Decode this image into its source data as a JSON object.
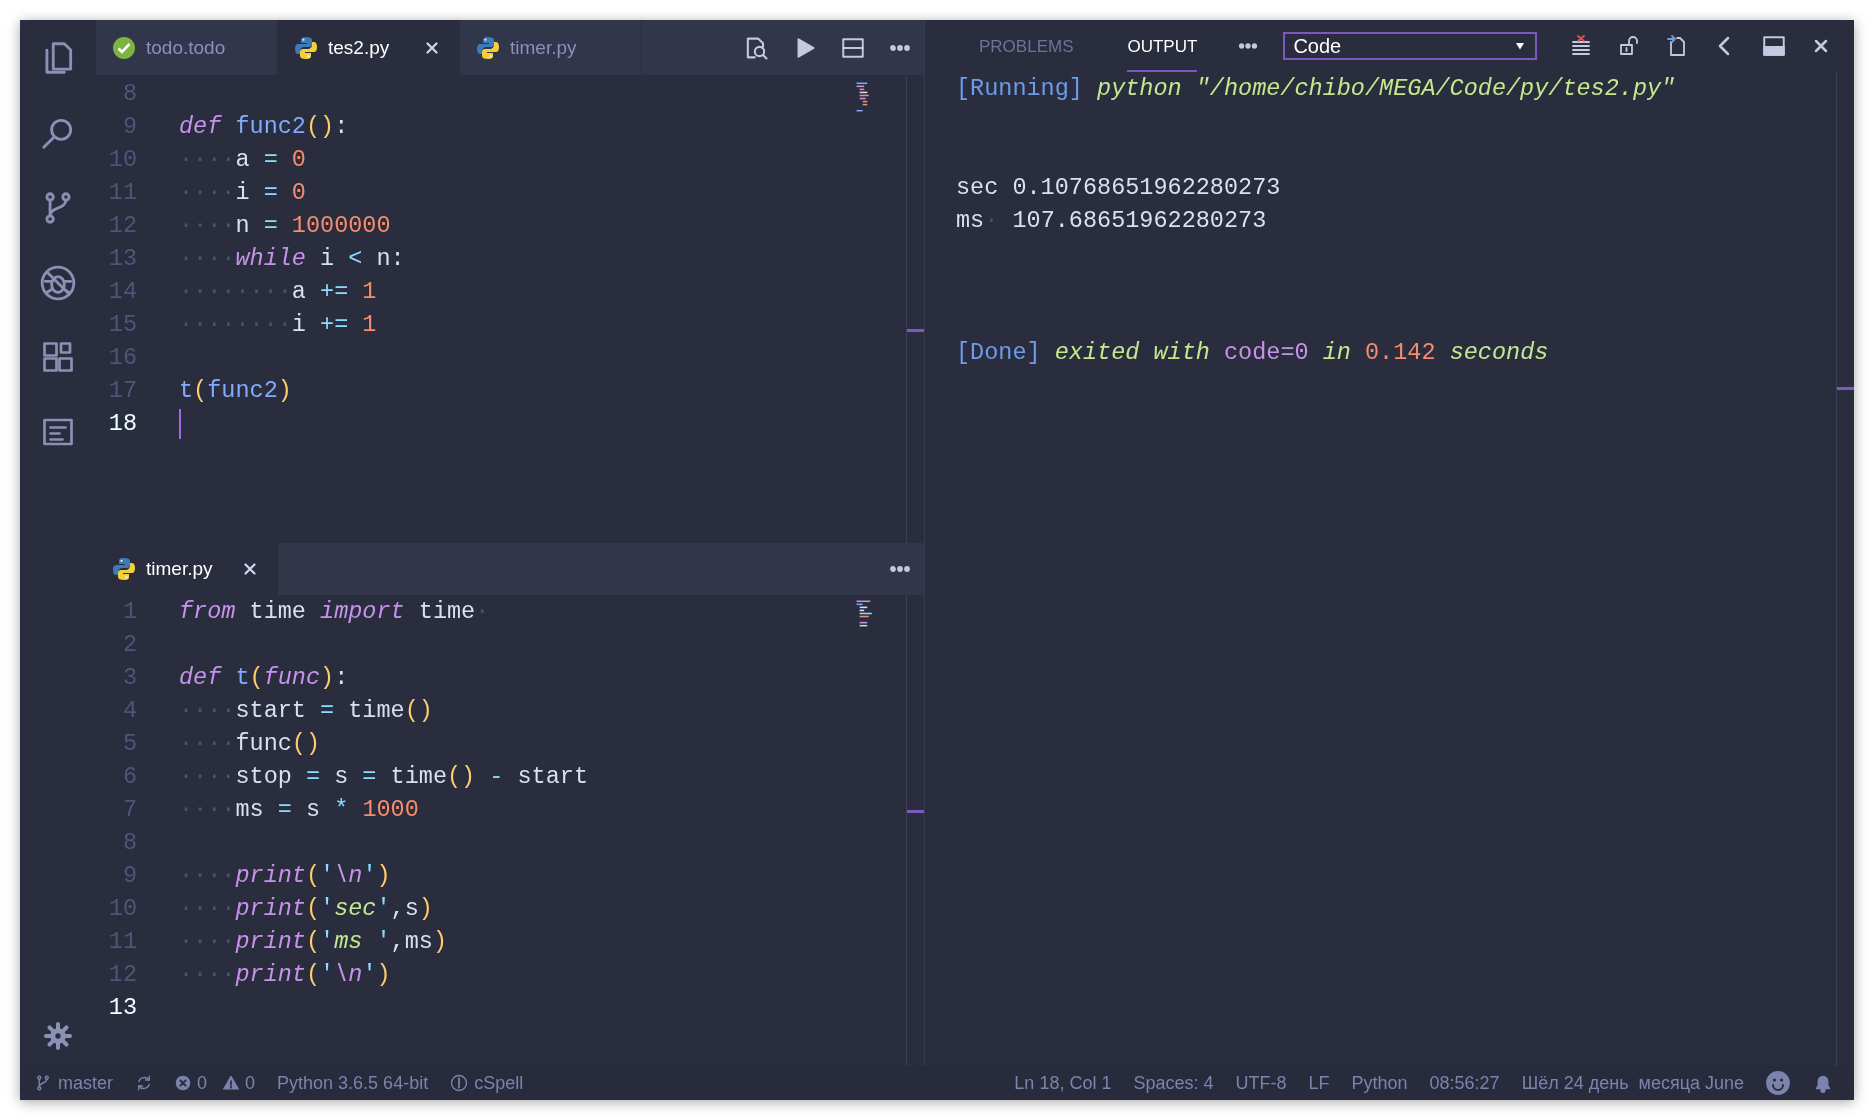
{
  "editor_top": {
    "focused": true,
    "tabs": [
      {
        "label": "todo.todo",
        "kind": "todo",
        "selected": false
      },
      {
        "label": "tes2.py",
        "kind": "python",
        "selected": true
      },
      {
        "label": "timer.py",
        "kind": "python",
        "selected": false
      }
    ],
    "lines": [
      {
        "number": "8",
        "current": false
      },
      {
        "number": "9",
        "current": false,
        "tokens": [
          {
            "kind": "kw",
            "text": "def "
          },
          {
            "kind": "fn",
            "text": "func2"
          },
          {
            "kind": "par",
            "text": "()"
          },
          {
            "kind": "plain",
            "text": ":"
          }
        ]
      },
      {
        "number": "10",
        "current": false,
        "tokens": [
          {
            "kind": "ws",
            "text": "····"
          },
          {
            "kind": "plain",
            "text": "a "
          },
          {
            "kind": "op",
            "text": "= "
          },
          {
            "kind": "num",
            "text": "0"
          }
        ]
      },
      {
        "number": "11",
        "current": false,
        "tokens": [
          {
            "kind": "ws",
            "text": "····"
          },
          {
            "kind": "plain",
            "text": "i "
          },
          {
            "kind": "op",
            "text": "= "
          },
          {
            "kind": "num",
            "text": "0"
          }
        ]
      },
      {
        "number": "12",
        "current": false,
        "tokens": [
          {
            "kind": "ws",
            "text": "····"
          },
          {
            "kind": "plain",
            "text": "n "
          },
          {
            "kind": "op",
            "text": "= "
          },
          {
            "kind": "num",
            "text": "1000000"
          }
        ]
      },
      {
        "number": "13",
        "current": false,
        "tokens": [
          {
            "kind": "ws",
            "text": "····"
          },
          {
            "kind": "kw",
            "text": "while"
          },
          {
            "kind": "plain",
            "text": " i "
          },
          {
            "kind": "op",
            "text": "<"
          },
          {
            "kind": "plain",
            "text": " n:"
          }
        ]
      },
      {
        "number": "14",
        "current": false,
        "tokens": [
          {
            "kind": "ws",
            "text": "········"
          },
          {
            "kind": "plain",
            "text": "a "
          },
          {
            "kind": "op",
            "text": "+= "
          },
          {
            "kind": "num",
            "text": "1"
          }
        ]
      },
      {
        "number": "15",
        "current": false,
        "tokens": [
          {
            "kind": "ws",
            "text": "········"
          },
          {
            "kind": "plain",
            "text": "i "
          },
          {
            "kind": "op",
            "text": "+= "
          },
          {
            "kind": "num",
            "text": "1"
          }
        ]
      },
      {
        "number": "16",
        "current": false
      },
      {
        "number": "17",
        "current": false,
        "tokens": [
          {
            "kind": "fn",
            "text": "t"
          },
          {
            "kind": "par",
            "text": "("
          },
          {
            "kind": "fn",
            "text": "func2"
          },
          {
            "kind": "par",
            "text": ")"
          }
        ]
      },
      {
        "number": "18",
        "current": true
      }
    ]
  },
  "editor_bottom": {
    "focused": false,
    "tabs": [
      {
        "label": "timer.py",
        "kind": "python",
        "selected": true
      }
    ],
    "lines": [
      {
        "number": "1",
        "current": false,
        "tokens": [
          {
            "kind": "kw",
            "text": "from"
          },
          {
            "kind": "plain",
            "text": " time "
          },
          {
            "kind": "kw",
            "text": "import"
          },
          {
            "kind": "plain",
            "text": " time"
          },
          {
            "kind": "ws",
            "text": "·"
          }
        ]
      },
      {
        "number": "2",
        "current": false
      },
      {
        "number": "3",
        "current": false,
        "tokens": [
          {
            "kind": "kw",
            "text": "def "
          },
          {
            "kind": "fn",
            "text": "t"
          },
          {
            "kind": "par",
            "text": "("
          },
          {
            "kind": "param",
            "text": "func"
          },
          {
            "kind": "par",
            "text": ")"
          },
          {
            "kind": "plain",
            "text": ":"
          }
        ]
      },
      {
        "number": "4",
        "current": false,
        "tokens": [
          {
            "kind": "ws",
            "text": "····"
          },
          {
            "kind": "plain",
            "text": "start "
          },
          {
            "kind": "op",
            "text": "="
          },
          {
            "kind": "plain",
            "text": " time"
          },
          {
            "kind": "par",
            "text": "()"
          }
        ]
      },
      {
        "number": "5",
        "current": false,
        "tokens": [
          {
            "kind": "ws",
            "text": "····"
          },
          {
            "kind": "plain",
            "text": "func"
          },
          {
            "kind": "par",
            "text": "()"
          }
        ]
      },
      {
        "number": "6",
        "current": false,
        "tokens": [
          {
            "kind": "ws",
            "text": "····"
          },
          {
            "kind": "plain",
            "text": "stop "
          },
          {
            "kind": "op",
            "text": "="
          },
          {
            "kind": "plain",
            "text": " s "
          },
          {
            "kind": "op",
            "text": "="
          },
          {
            "kind": "plain",
            "text": " time"
          },
          {
            "kind": "par",
            "text": "() "
          },
          {
            "kind": "op",
            "text": "-"
          },
          {
            "kind": "plain",
            "text": " start"
          }
        ]
      },
      {
        "number": "7",
        "current": false,
        "tokens": [
          {
            "kind": "ws",
            "text": "····"
          },
          {
            "kind": "plain",
            "text": "ms "
          },
          {
            "kind": "op",
            "text": "="
          },
          {
            "kind": "plain",
            "text": " s "
          },
          {
            "kind": "op",
            "text": "* "
          },
          {
            "kind": "num",
            "text": "1000"
          }
        ]
      },
      {
        "number": "8",
        "current": false
      },
      {
        "number": "9",
        "current": false,
        "tokens": [
          {
            "kind": "ws",
            "text": "····"
          },
          {
            "kind": "kw",
            "text": "print"
          },
          {
            "kind": "par",
            "text": "("
          },
          {
            "kind": "op",
            "text": "'"
          },
          {
            "kind": "esc",
            "text": "\\n"
          },
          {
            "kind": "op",
            "text": "'"
          },
          {
            "kind": "par",
            "text": ")"
          }
        ]
      },
      {
        "number": "10",
        "current": false,
        "tokens": [
          {
            "kind": "ws",
            "text": "····"
          },
          {
            "kind": "kw",
            "text": "print"
          },
          {
            "kind": "par",
            "text": "("
          },
          {
            "kind": "op",
            "text": "'"
          },
          {
            "kind": "str",
            "text": "sec"
          },
          {
            "kind": "op",
            "text": "'"
          },
          {
            "kind": "plain",
            "text": ",s"
          },
          {
            "kind": "par",
            "text": ")"
          }
        ]
      },
      {
        "number": "11",
        "current": false,
        "tokens": [
          {
            "kind": "ws",
            "text": "····"
          },
          {
            "kind": "kw",
            "text": "print"
          },
          {
            "kind": "par",
            "text": "("
          },
          {
            "kind": "op",
            "text": "'"
          },
          {
            "kind": "str",
            "text": "ms "
          },
          {
            "kind": "op",
            "text": "'"
          },
          {
            "kind": "plain",
            "text": ",ms"
          },
          {
            "kind": "par",
            "text": ")"
          }
        ]
      },
      {
        "number": "12",
        "current": false,
        "tokens": [
          {
            "kind": "ws",
            "text": "····"
          },
          {
            "kind": "kw",
            "text": "print"
          },
          {
            "kind": "par",
            "text": "("
          },
          {
            "kind": "op",
            "text": "'"
          },
          {
            "kind": "esc",
            "text": "\\n"
          },
          {
            "kind": "op",
            "text": "'"
          },
          {
            "kind": "par",
            "text": ")"
          }
        ]
      },
      {
        "number": "13",
        "current": true
      }
    ]
  },
  "panel": {
    "tabs": [
      {
        "label": "PROBLEMS",
        "selected": false
      },
      {
        "label": "OUTPUT",
        "selected": true
      }
    ],
    "channel": "Code",
    "output": [
      {
        "kind": "running",
        "tokens": [
          {
            "kind": "tag",
            "text": "[Running]"
          },
          {
            "kind": "ital",
            "text": " python \"/home/chibo/MEGA/Code/py/tes2.py\""
          }
        ]
      },
      {
        "kind": "result",
        "tokens": [
          {
            "kind": "plain",
            "text": "sec 0.10768651962280273"
          }
        ]
      },
      {
        "kind": "result",
        "tokens": [
          {
            "kind": "plain",
            "text": "ms"
          },
          {
            "kind": "ws",
            "text": "·"
          },
          {
            "kind": "plain",
            "text": " 107.68651962280273"
          }
        ]
      },
      {
        "kind": "done",
        "tokens": [
          {
            "kind": "tag",
            "text": "[Done]"
          },
          {
            "kind": "ital",
            "text": " exited with "
          },
          {
            "kind": "code",
            "text": "code=0"
          },
          {
            "kind": "ital",
            "text": " in "
          },
          {
            "kind": "num",
            "text": "0.142"
          },
          {
            "kind": "ital",
            "text": " seconds"
          }
        ]
      }
    ]
  },
  "status_bar": {
    "branch": "master",
    "errors": "0",
    "warnings": "0",
    "interpreter": "Python 3.6.5 64-bit",
    "spell": "cSpell",
    "position": "Ln 18, Col 1",
    "indent": "Spaces: 4",
    "encoding": "UTF-8",
    "eol": "LF",
    "language": "Python",
    "time": "08:56:27",
    "date": "Шёл 24 день  месяца June"
  }
}
